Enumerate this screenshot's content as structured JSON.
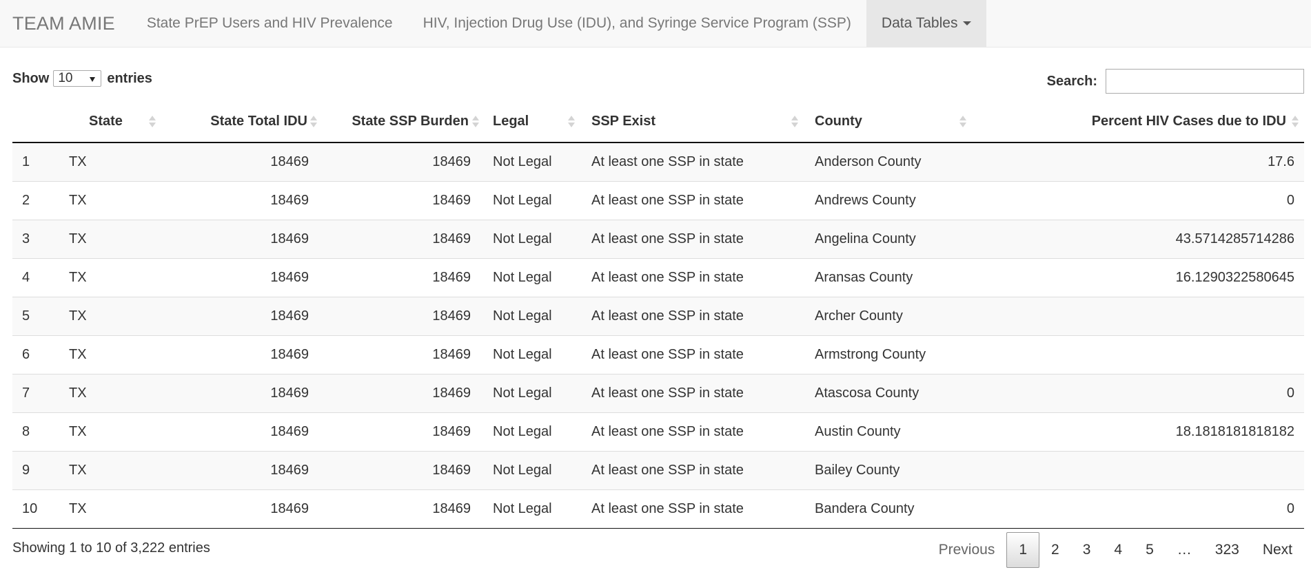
{
  "navbar": {
    "brand": "TEAM AMIE",
    "links": [
      "State PrEP Users and HIV Prevalence",
      "HIV, Injection Drug Use (IDU), and Syringe Service Program (SSP)"
    ],
    "dropdown": "Data Tables"
  },
  "controls": {
    "show_label": "Show",
    "entries_value": "10",
    "entries_label": "entries",
    "search_label": "Search:",
    "search_value": ""
  },
  "table": {
    "columns": [
      "",
      "State",
      "State Total IDU",
      "State SSP Burden",
      "Legal",
      "SSP Exist",
      "County",
      "Percent HIV Cases due to IDU"
    ],
    "rows": [
      [
        "1",
        "TX",
        "18469",
        "18469",
        "Not Legal",
        "At least one SSP in state",
        "Anderson County",
        "17.6"
      ],
      [
        "2",
        "TX",
        "18469",
        "18469",
        "Not Legal",
        "At least one SSP in state",
        "Andrews County",
        "0"
      ],
      [
        "3",
        "TX",
        "18469",
        "18469",
        "Not Legal",
        "At least one SSP in state",
        "Angelina County",
        "43.5714285714286"
      ],
      [
        "4",
        "TX",
        "18469",
        "18469",
        "Not Legal",
        "At least one SSP in state",
        "Aransas County",
        "16.1290322580645"
      ],
      [
        "5",
        "TX",
        "18469",
        "18469",
        "Not Legal",
        "At least one SSP in state",
        "Archer County",
        ""
      ],
      [
        "6",
        "TX",
        "18469",
        "18469",
        "Not Legal",
        "At least one SSP in state",
        "Armstrong County",
        ""
      ],
      [
        "7",
        "TX",
        "18469",
        "18469",
        "Not Legal",
        "At least one SSP in state",
        "Atascosa County",
        "0"
      ],
      [
        "8",
        "TX",
        "18469",
        "18469",
        "Not Legal",
        "At least one SSP in state",
        "Austin County",
        "18.1818181818182"
      ],
      [
        "9",
        "TX",
        "18469",
        "18469",
        "Not Legal",
        "At least one SSP in state",
        "Bailey County",
        ""
      ],
      [
        "10",
        "TX",
        "18469",
        "18469",
        "Not Legal",
        "At least one SSP in state",
        "Bandera County",
        "0"
      ]
    ]
  },
  "footer": {
    "info": "Showing 1 to 10 of 3,222 entries",
    "pagination": {
      "previous": "Previous",
      "pages": [
        "1",
        "2",
        "3",
        "4",
        "5",
        "…",
        "323"
      ],
      "current": "1",
      "next": "Next"
    }
  }
}
